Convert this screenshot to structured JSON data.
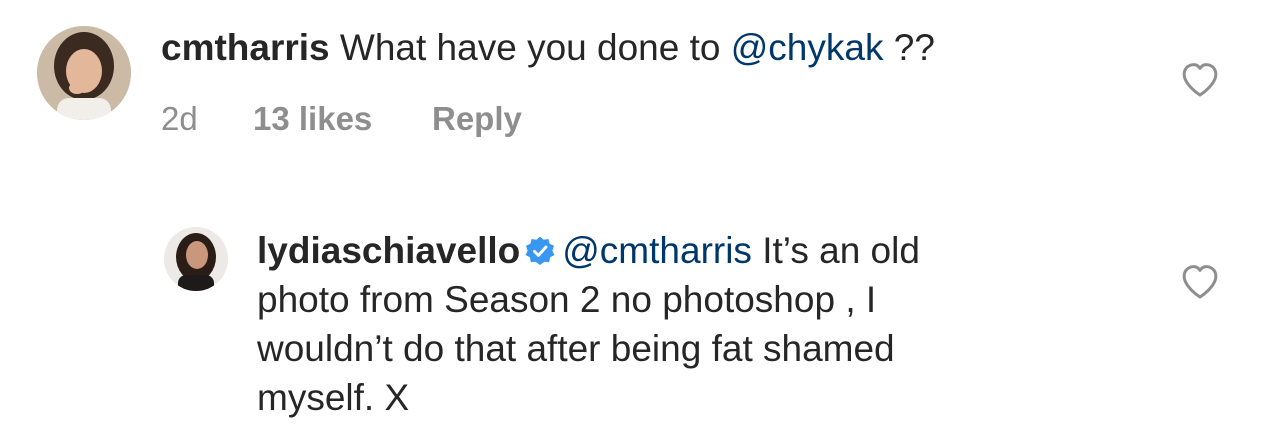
{
  "comments": [
    {
      "username": "cmtharris",
      "text": "What have you done to",
      "mention": "@chykak",
      "suffix": "??",
      "time": "2d",
      "likes": "13 likes",
      "reply_label": "Reply",
      "avatar_icon": "avatar-photo",
      "like_icon": "heart-outline-icon"
    }
  ],
  "replies": [
    {
      "username": "lydiaschiavello",
      "verified": true,
      "verified_icon": "verified-badge-icon",
      "mention": "@cmtharris",
      "text_line1": "It’s an old",
      "text_line2": "photo from Season 2 no photoshop , I",
      "text_line3": "wouldn’t do that after being fat shamed",
      "text_line4": "myself. X",
      "avatar_icon": "avatar-photo",
      "like_icon": "heart-outline-icon"
    }
  ],
  "colors": {
    "text": "#262626",
    "secondary": "#8e8e8e",
    "mention": "#00376b",
    "verified": "#3897f0"
  }
}
